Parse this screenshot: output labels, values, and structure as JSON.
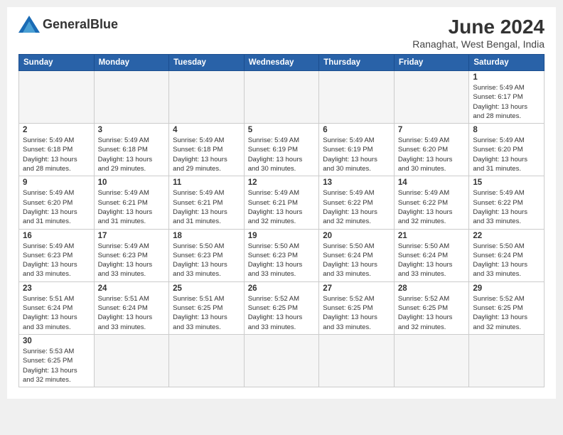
{
  "header": {
    "month_year": "June 2024",
    "location": "Ranaghat, West Bengal, India",
    "logo_text_regular": "General",
    "logo_text_bold": "Blue"
  },
  "days_of_week": [
    "Sunday",
    "Monday",
    "Tuesday",
    "Wednesday",
    "Thursday",
    "Friday",
    "Saturday"
  ],
  "weeks": [
    [
      {
        "day": "",
        "empty": true
      },
      {
        "day": "",
        "empty": true
      },
      {
        "day": "",
        "empty": true
      },
      {
        "day": "",
        "empty": true
      },
      {
        "day": "",
        "empty": true
      },
      {
        "day": "",
        "empty": true
      },
      {
        "day": "1",
        "sunrise": "5:49 AM",
        "sunset": "6:17 PM",
        "daylight": "13 hours and 28 minutes."
      }
    ],
    [
      {
        "day": "2",
        "sunrise": "5:49 AM",
        "sunset": "6:18 PM",
        "daylight": "13 hours and 28 minutes."
      },
      {
        "day": "3",
        "sunrise": "5:49 AM",
        "sunset": "6:18 PM",
        "daylight": "13 hours and 29 minutes."
      },
      {
        "day": "4",
        "sunrise": "5:49 AM",
        "sunset": "6:18 PM",
        "daylight": "13 hours and 29 minutes."
      },
      {
        "day": "5",
        "sunrise": "5:49 AM",
        "sunset": "6:19 PM",
        "daylight": "13 hours and 30 minutes."
      },
      {
        "day": "6",
        "sunrise": "5:49 AM",
        "sunset": "6:19 PM",
        "daylight": "13 hours and 30 minutes."
      },
      {
        "day": "7",
        "sunrise": "5:49 AM",
        "sunset": "6:20 PM",
        "daylight": "13 hours and 30 minutes."
      },
      {
        "day": "8",
        "sunrise": "5:49 AM",
        "sunset": "6:20 PM",
        "daylight": "13 hours and 31 minutes."
      }
    ],
    [
      {
        "day": "9",
        "sunrise": "5:49 AM",
        "sunset": "6:20 PM",
        "daylight": "13 hours and 31 minutes."
      },
      {
        "day": "10",
        "sunrise": "5:49 AM",
        "sunset": "6:21 PM",
        "daylight": "13 hours and 31 minutes."
      },
      {
        "day": "11",
        "sunrise": "5:49 AM",
        "sunset": "6:21 PM",
        "daylight": "13 hours and 31 minutes."
      },
      {
        "day": "12",
        "sunrise": "5:49 AM",
        "sunset": "6:21 PM",
        "daylight": "13 hours and 32 minutes."
      },
      {
        "day": "13",
        "sunrise": "5:49 AM",
        "sunset": "6:22 PM",
        "daylight": "13 hours and 32 minutes."
      },
      {
        "day": "14",
        "sunrise": "5:49 AM",
        "sunset": "6:22 PM",
        "daylight": "13 hours and 32 minutes."
      },
      {
        "day": "15",
        "sunrise": "5:49 AM",
        "sunset": "6:22 PM",
        "daylight": "13 hours and 33 minutes."
      }
    ],
    [
      {
        "day": "16",
        "sunrise": "5:49 AM",
        "sunset": "6:23 PM",
        "daylight": "13 hours and 33 minutes."
      },
      {
        "day": "17",
        "sunrise": "5:49 AM",
        "sunset": "6:23 PM",
        "daylight": "13 hours and 33 minutes."
      },
      {
        "day": "18",
        "sunrise": "5:50 AM",
        "sunset": "6:23 PM",
        "daylight": "13 hours and 33 minutes."
      },
      {
        "day": "19",
        "sunrise": "5:50 AM",
        "sunset": "6:23 PM",
        "daylight": "13 hours and 33 minutes."
      },
      {
        "day": "20",
        "sunrise": "5:50 AM",
        "sunset": "6:24 PM",
        "daylight": "13 hours and 33 minutes."
      },
      {
        "day": "21",
        "sunrise": "5:50 AM",
        "sunset": "6:24 PM",
        "daylight": "13 hours and 33 minutes."
      },
      {
        "day": "22",
        "sunrise": "5:50 AM",
        "sunset": "6:24 PM",
        "daylight": "13 hours and 33 minutes."
      }
    ],
    [
      {
        "day": "23",
        "sunrise": "5:51 AM",
        "sunset": "6:24 PM",
        "daylight": "13 hours and 33 minutes."
      },
      {
        "day": "24",
        "sunrise": "5:51 AM",
        "sunset": "6:24 PM",
        "daylight": "13 hours and 33 minutes."
      },
      {
        "day": "25",
        "sunrise": "5:51 AM",
        "sunset": "6:25 PM",
        "daylight": "13 hours and 33 minutes."
      },
      {
        "day": "26",
        "sunrise": "5:52 AM",
        "sunset": "6:25 PM",
        "daylight": "13 hours and 33 minutes."
      },
      {
        "day": "27",
        "sunrise": "5:52 AM",
        "sunset": "6:25 PM",
        "daylight": "13 hours and 33 minutes."
      },
      {
        "day": "28",
        "sunrise": "5:52 AM",
        "sunset": "6:25 PM",
        "daylight": "13 hours and 32 minutes."
      },
      {
        "day": "29",
        "sunrise": "5:52 AM",
        "sunset": "6:25 PM",
        "daylight": "13 hours and 32 minutes."
      }
    ],
    [
      {
        "day": "30",
        "sunrise": "5:53 AM",
        "sunset": "6:25 PM",
        "daylight": "13 hours and 32 minutes."
      },
      {
        "day": "",
        "empty": true
      },
      {
        "day": "",
        "empty": true
      },
      {
        "day": "",
        "empty": true
      },
      {
        "day": "",
        "empty": true
      },
      {
        "day": "",
        "empty": true
      },
      {
        "day": "",
        "empty": true
      }
    ]
  ]
}
